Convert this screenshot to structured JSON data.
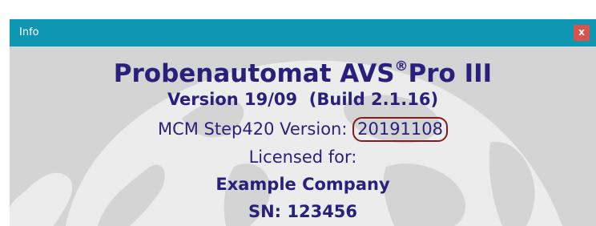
{
  "window": {
    "title": "Info",
    "close_glyph": "x"
  },
  "about": {
    "product_name": "Probenautomat AVS",
    "registered_mark": "®",
    "product_suffix": "Pro III",
    "version_line": "Version 19/09  (Build 2.1.16)",
    "mcm_label": "MCM Step420 Version: ",
    "mcm_version": "20191108",
    "licensed_label": "Licensed for:",
    "company": "Example Company",
    "serial": "SN: 123456"
  },
  "colors": {
    "titlebar": "#0e96b2",
    "close_button": "#d9534f",
    "background": "#d4d4d4",
    "globe": "#ececec",
    "text": "#2a1f7a",
    "highlight_circle": "#8a1a1a"
  },
  "icons": {
    "close": "close-icon",
    "background_art": "globe-watermark"
  }
}
